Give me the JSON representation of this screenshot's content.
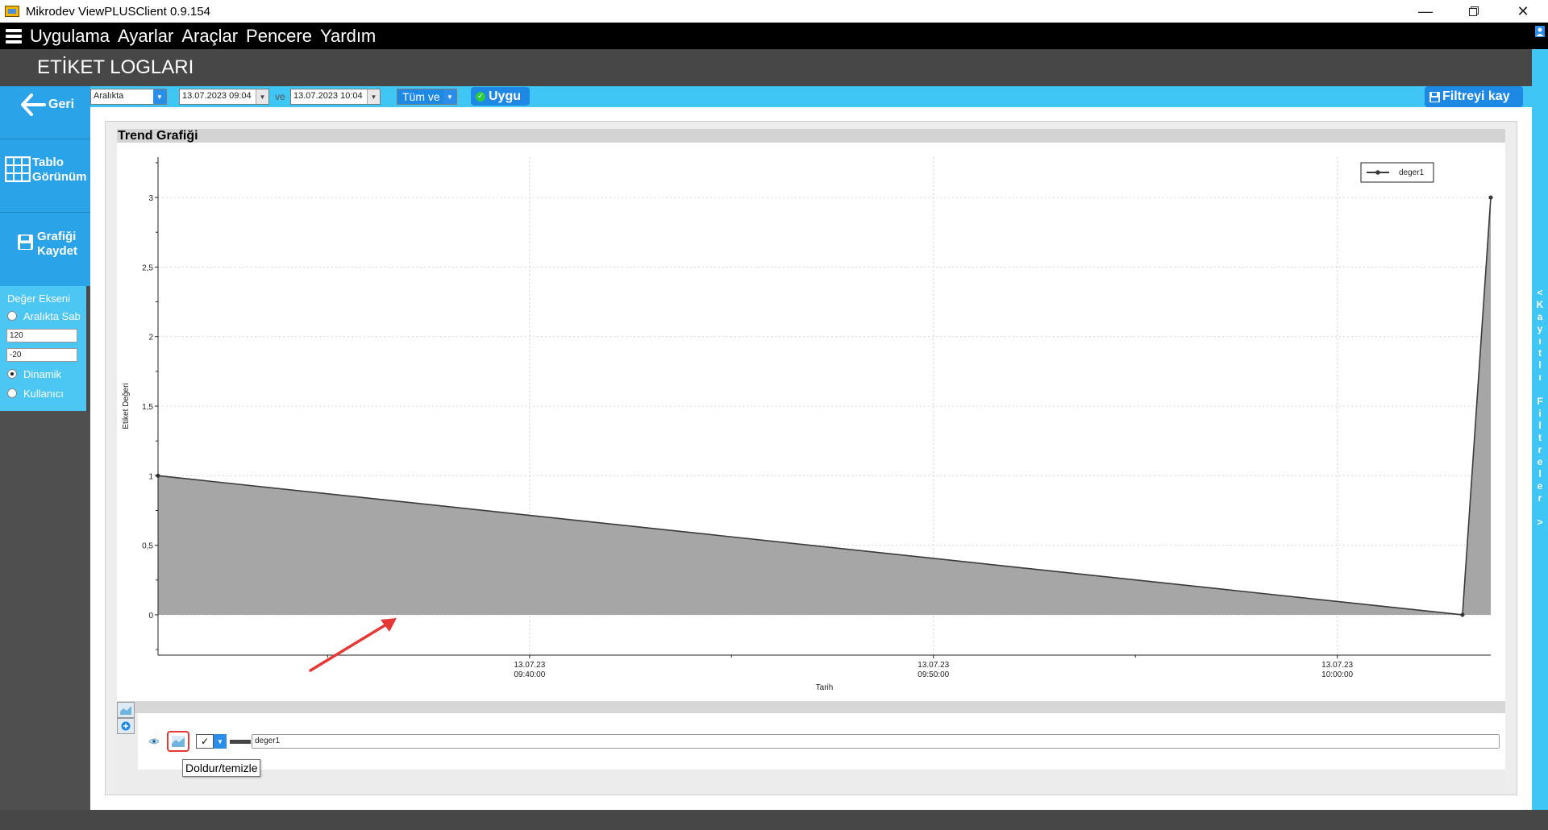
{
  "window": {
    "title": "Mikrodev ViewPLUSClient 0.9.154"
  },
  "menu": {
    "items": [
      "Uygulama",
      "Ayarlar",
      "Araçlar",
      "Pencere",
      "Yardım"
    ]
  },
  "page": {
    "title": "ETİKET LOGLARI"
  },
  "sidebar": {
    "back_label": "Geri",
    "table_view_label": [
      "Tablo",
      "Görünüm"
    ],
    "save_chart_label": [
      "Grafiği",
      "Kaydet"
    ]
  },
  "axis_panel": {
    "title": "Değer Ekseni",
    "options": [
      "Aralıkta Sab",
      "Dinamik",
      "Kullanıcı"
    ],
    "selected": "Dinamik",
    "max_value": "120",
    "min_value": "-20"
  },
  "filter": {
    "mode": "Aralıkta",
    "start": "13.07.2023 09:04",
    "connector": "ve",
    "end": "13.07.2023 10:04",
    "scope": "Tüm ve",
    "apply_label": "Uygu",
    "save_label": "Filtreyi kay"
  },
  "right_bar": {
    "label": "<\nK\na\ny\nı\nt\nl\nı\n\nF\ni\nl\nt\nr\ne\nl\ne\nr\n\n>"
  },
  "chart": {
    "header": "Trend Grafiği"
  },
  "chart_data": {
    "type": "area",
    "title": "",
    "xlabel": "Tarih",
    "ylabel": "Etiket Değeri",
    "x_ticks": [
      {
        "time": "09:40:00",
        "date": "13.07.23",
        "minutes": 40
      },
      {
        "time": "09:50:00",
        "date": "13.07.23",
        "minutes": 50
      },
      {
        "time": "10:00:00",
        "date": "13.07.23",
        "minutes": 60
      }
    ],
    "xlim_minutes": [
      30.8,
      63.8
    ],
    "y_ticks": [
      "3",
      "2,5",
      "2",
      "1,5",
      "1",
      "0,5",
      "0"
    ],
    "ylim": [
      -0.29,
      3.29
    ],
    "grid": true,
    "legend": "top-right",
    "series": [
      {
        "name": "deger1",
        "color": "#3a3a3a",
        "fill": "#a6a6a6",
        "points": [
          {
            "minutes": 30.8,
            "value": 1
          },
          {
            "minutes": 63.1,
            "value": 0
          },
          {
            "minutes": 63.8,
            "value": 3
          }
        ]
      }
    ]
  },
  "series_editor": {
    "name": "deger1"
  },
  "tooltip": {
    "text": "Doldur/temizle"
  }
}
